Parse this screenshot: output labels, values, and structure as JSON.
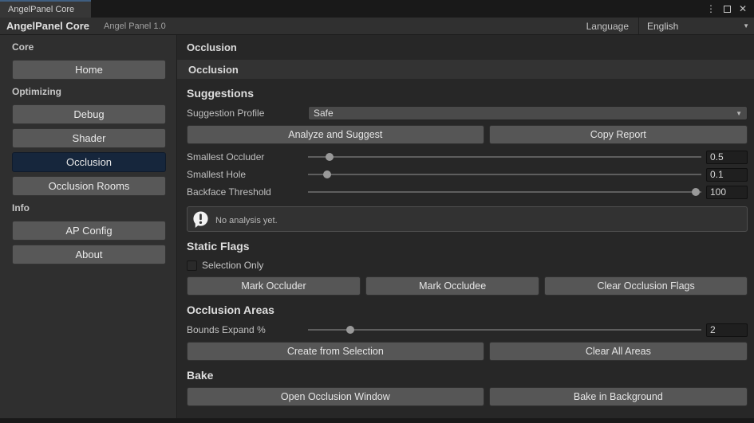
{
  "colors": {
    "bg_window": "#191919",
    "tab_indicator": "#3f5e80",
    "accent_selected": "#16263c"
  },
  "icons": {
    "menu": "⋮",
    "close": "✕",
    "dropdown_arrow": "▼"
  },
  "window": {
    "tab_title": "AngelPanel Core"
  },
  "toolbar": {
    "title": "AngelPanel Core",
    "version": "Angel Panel 1.0",
    "language_label": "Language",
    "language_value": "English"
  },
  "sidebar": {
    "sections": [
      {
        "label": "Core",
        "items": [
          {
            "label": "Home",
            "active": false
          }
        ]
      },
      {
        "label": "Optimizing",
        "items": [
          {
            "label": "Debug",
            "active": false
          },
          {
            "label": "Shader",
            "active": false
          },
          {
            "label": "Occlusion",
            "active": true
          },
          {
            "label": "Occlusion Rooms",
            "active": false
          }
        ]
      },
      {
        "label": "Info",
        "items": [
          {
            "label": "AP Config",
            "active": false
          },
          {
            "label": "About",
            "active": false
          }
        ]
      }
    ]
  },
  "main": {
    "page_title": "Occlusion",
    "section_band": "Occlusion",
    "suggestions": {
      "header": "Suggestions",
      "profile_label": "Suggestion Profile",
      "profile_value": "Safe",
      "buttons": [
        "Analyze and Suggest",
        "Copy Report"
      ],
      "sliders": [
        {
          "label": "Smallest Occluder",
          "value": "0.5",
          "pct": 5.5
        },
        {
          "label": "Smallest Hole",
          "value": "0.1",
          "pct": 4.8
        },
        {
          "label": "Backface Threshold",
          "value": "100",
          "pct": 98.6
        }
      ],
      "notice": "No analysis yet."
    },
    "static_flags": {
      "header": "Static Flags",
      "checkbox_label": "Selection Only",
      "checked": false,
      "buttons": [
        "Mark Occluder",
        "Mark Occludee",
        "Clear Occlusion Flags"
      ]
    },
    "occlusion_areas": {
      "header": "Occlusion Areas",
      "slider": {
        "label": "Bounds Expand %",
        "value": "2",
        "pct": 10.7
      },
      "buttons": [
        "Create from Selection",
        "Clear All Areas"
      ]
    },
    "bake": {
      "header": "Bake",
      "buttons": [
        "Open Occlusion Window",
        "Bake in Background"
      ]
    }
  }
}
